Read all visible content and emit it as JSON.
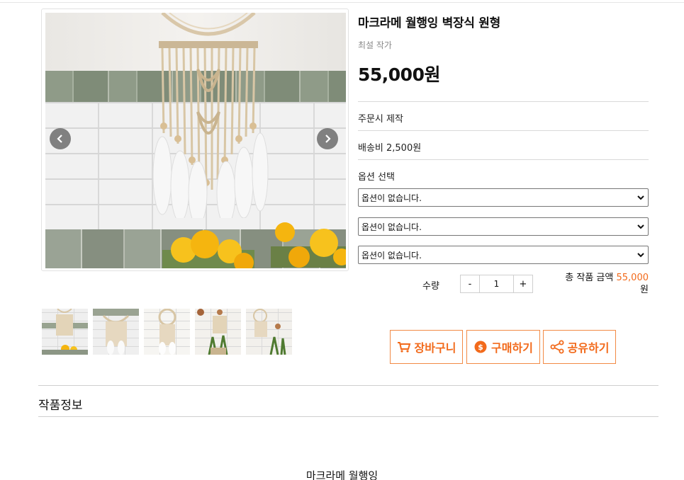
{
  "product": {
    "title": "마크라메 월행잉 벽장식 원형",
    "artist": "최설 작가",
    "price": "55,000원",
    "made_to_order": "주문시 제작",
    "shipping": "배송비 2,500원",
    "option_label": "옵션 선택",
    "options": [
      {
        "selected": "옵션이 없습니다."
      },
      {
        "selected": "옵션이 없습니다."
      },
      {
        "selected": "옵션이 없습니다."
      }
    ],
    "quantity_label": "수량",
    "quantity": "1",
    "minus": "-",
    "plus": "+",
    "total_label": "총 작품 금액",
    "total_amount": "55,000",
    "total_unit": "원"
  },
  "actions": {
    "cart": "장바구니",
    "buy": "구매하기",
    "share": "공유하기"
  },
  "section": {
    "info_title": "작품정보",
    "desc_title": "마크라메 월행잉"
  },
  "gallery": {
    "thumbnail_count": 5
  },
  "colors": {
    "accent": "#f26a1b",
    "accent_border": "#f28a45"
  },
  "icons": {
    "prev": "chevron-left-icon",
    "next": "chevron-right-icon",
    "cart": "cart-icon",
    "buy": "coin-icon",
    "share": "share-icon",
    "select": "chevron-down-icon"
  }
}
